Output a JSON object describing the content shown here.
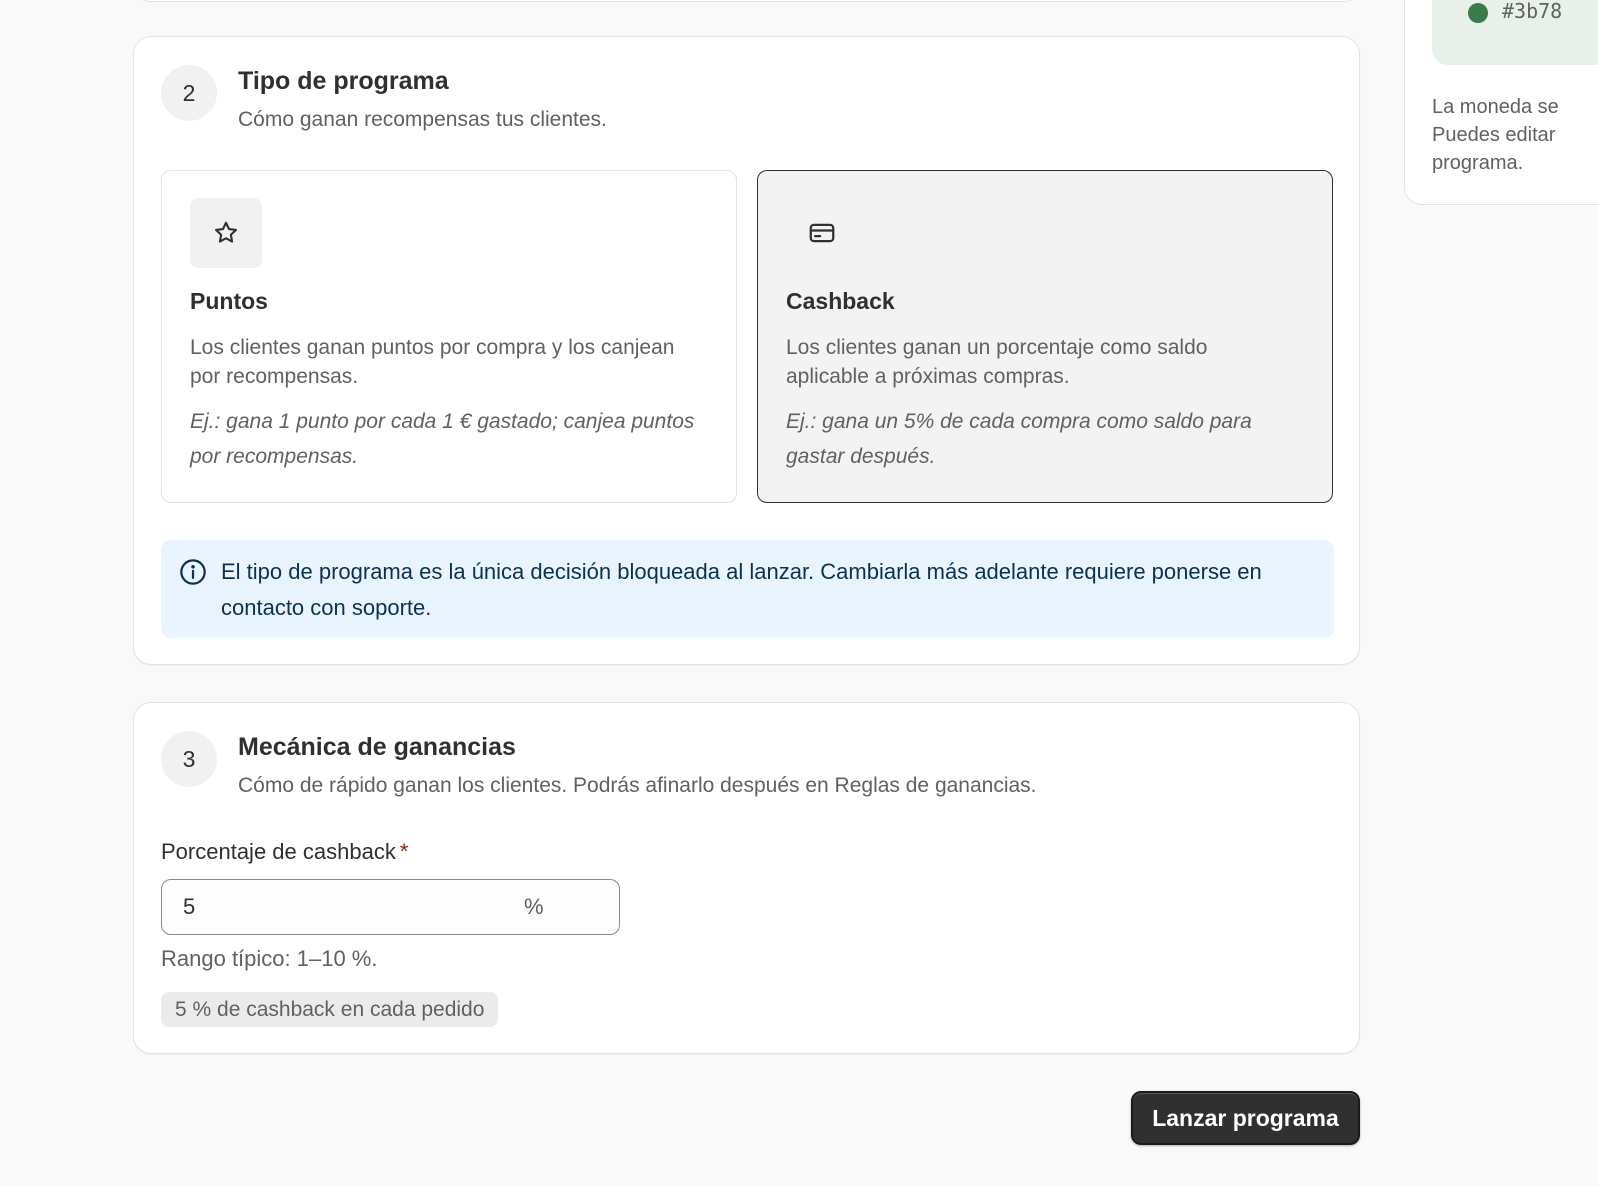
{
  "step2": {
    "number": "2",
    "title": "Tipo de programa",
    "subtitle": "Cómo ganan recompensas tus clientes.",
    "options": [
      {
        "icon": "star-icon",
        "title": "Puntos",
        "description": "Los clientes ganan puntos por compra y los canjean por recompensas.",
        "example": "Ej.: gana 1 punto por cada 1 € gastado; canjea puntos por recompensas.",
        "selected": false
      },
      {
        "icon": "credit-card-icon",
        "title": "Cashback",
        "description": "Los clientes ganan un porcentaje como saldo aplicable a próximas compras.",
        "example": "Ej.: gana un 5% de cada compra como saldo para gastar después.",
        "selected": true
      }
    ],
    "info_banner": "El tipo de programa es la única decisión bloqueada al lanzar. Cambiarla más adelante requiere ponerse en contacto con soporte."
  },
  "step3": {
    "number": "3",
    "title": "Mecánica de ganancias",
    "subtitle": "Cómo de rápido ganan los clientes. Podrás afinarlo después en Reglas de ganancias.",
    "field": {
      "label": "Porcentaje de cashback",
      "required_mark": "*",
      "value": "5",
      "suffix": "%",
      "help": "Rango típico: 1–10 %."
    },
    "preview": "5 % de cashback en cada pedido"
  },
  "actions": {
    "launch_label": "Lanzar programa"
  },
  "side_panel": {
    "color_hex": "#3b78",
    "dot_color": "#3b7a4a",
    "note": "La moneda se\nPuedes editar\nprograma."
  },
  "colors": {
    "accent_dark": "#303030",
    "info_bg": "#eaf4ff",
    "required": "#8e1f0b"
  }
}
